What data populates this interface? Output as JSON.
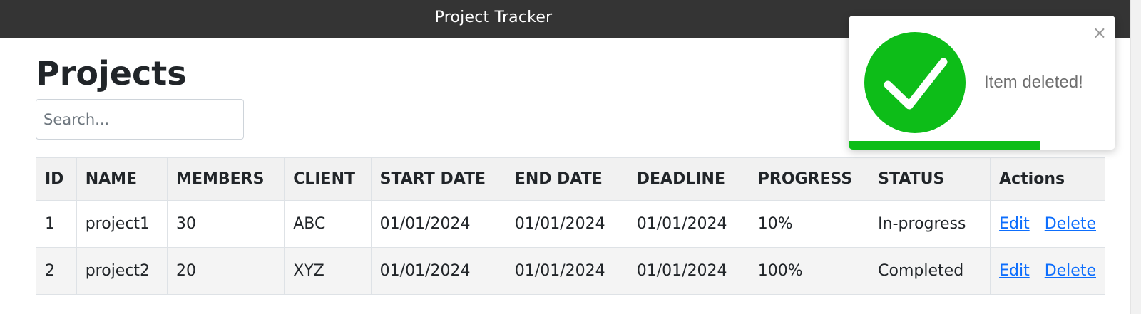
{
  "header": {
    "title": "Project Tracker"
  },
  "page": {
    "title": "Projects"
  },
  "search": {
    "placeholder": "Search...",
    "value": ""
  },
  "table": {
    "columns": [
      "ID",
      "NAME",
      "MEMBERS",
      "CLIENT",
      "START DATE",
      "END DATE",
      "DEADLINE",
      "PROGRESS",
      "STATUS",
      "Actions"
    ],
    "rows": [
      {
        "id": "1",
        "name": "project1",
        "members": "30",
        "client": "ABC",
        "start_date": "01/01/2024",
        "end_date": "01/01/2024",
        "deadline": "01/01/2024",
        "progress": "10%",
        "status": "In-progress",
        "edit": "Edit",
        "delete": "Delete"
      },
      {
        "id": "2",
        "name": "project2",
        "members": "20",
        "client": "XYZ",
        "start_date": "01/01/2024",
        "end_date": "01/01/2024",
        "deadline": "01/01/2024",
        "progress": "100%",
        "status": "Completed",
        "edit": "Edit",
        "delete": "Delete"
      }
    ]
  },
  "toast": {
    "message": "Item deleted!",
    "close_symbol": "×",
    "icon": "check-circle-icon",
    "timer_remaining": 0.72,
    "accent_color": "#0dbd18"
  },
  "colors": {
    "header_bg": "#343434",
    "link": "#0d6efd",
    "success": "#0dbd18"
  }
}
